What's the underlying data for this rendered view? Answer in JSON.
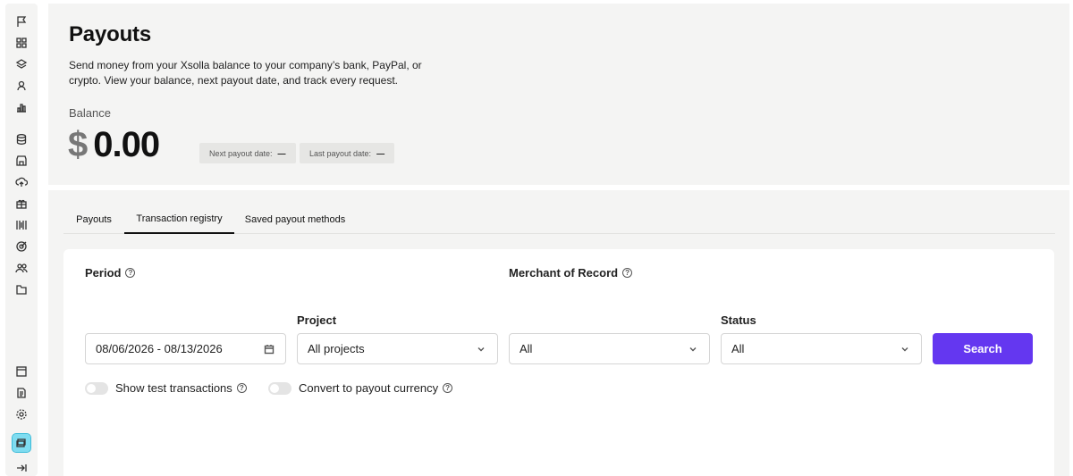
{
  "sidebar": {
    "icons": [
      "flag-icon",
      "grid-icon",
      "layers-icon",
      "user-icon",
      "bar-chart-icon",
      "database-icon",
      "store-icon",
      "cloud-upload-icon",
      "gift-icon",
      "barcode-icon",
      "target-icon",
      "users-icon",
      "folder-icon",
      "browser-icon",
      "document-icon",
      "gear-icon",
      "payouts-icon",
      "collapse-icon"
    ],
    "active": "payouts-icon"
  },
  "header": {
    "title": "Payouts",
    "description": "Send money from your Xsolla balance to your company’s bank, PayPal, or crypto. View your balance, next payout date, and track every request.",
    "balance_label": "Balance",
    "currency": "$",
    "amount": "0.00",
    "next_payout_label": "Next payout date:",
    "next_payout_value": "—",
    "last_payout_label": "Last payout date:",
    "last_payout_value": "—"
  },
  "tabs": [
    {
      "label": "Payouts"
    },
    {
      "label": "Transaction registry"
    },
    {
      "label": "Saved payout methods"
    }
  ],
  "active_tab": "Transaction registry",
  "filters": {
    "period_label": "Period",
    "period_value": "08/06/2026 - 08/13/2026",
    "merchant_label": "Merchant of Record",
    "merchant_value": "All",
    "project_label": "Project",
    "project_value": "All projects",
    "status_label": "Status",
    "status_value": "All",
    "search_label": "Search",
    "test_toggle_label": "Show test transactions",
    "currency_toggle_label": "Convert to payout currency",
    "help_glyph": "?"
  },
  "colors": {
    "accent": "#6437f0",
    "background": "#f4f4f3",
    "active_sidebar": "#7fdcf0"
  }
}
